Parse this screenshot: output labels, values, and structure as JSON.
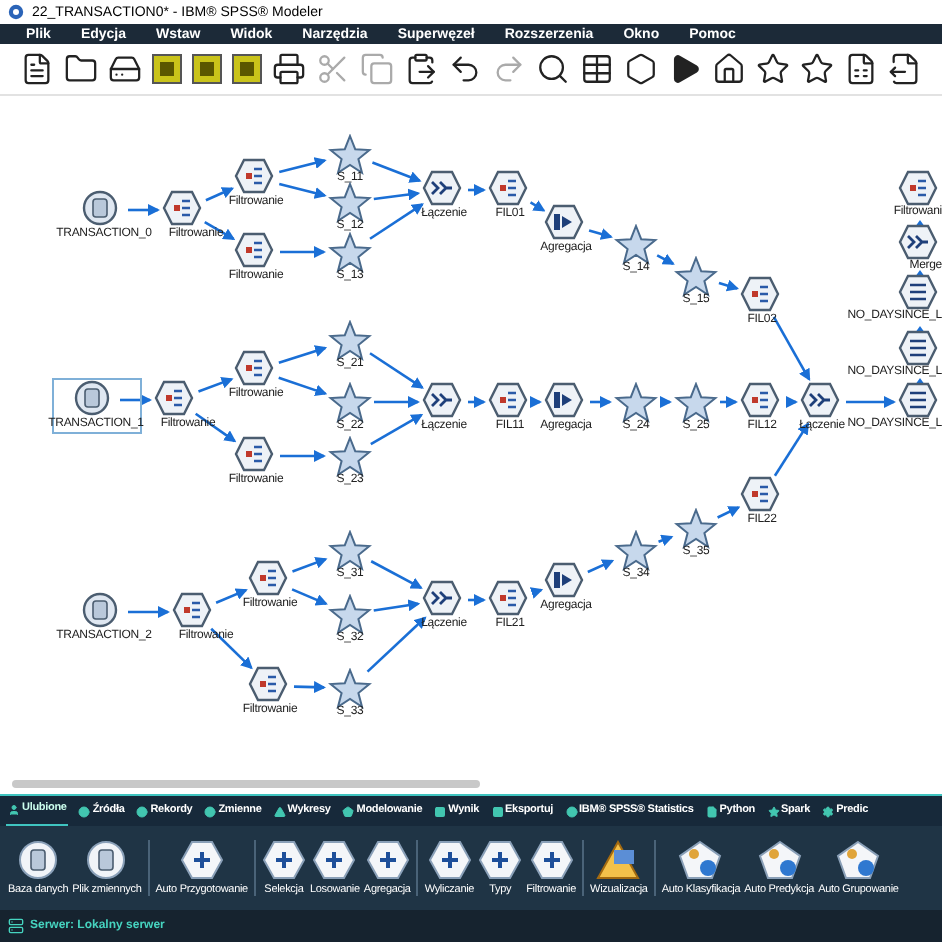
{
  "window": {
    "title": "22_TRANSACTION0* - IBM® SPSS® Modeler"
  },
  "menu": [
    "Plik",
    "Edycja",
    "Wstaw",
    "Widok",
    "Narzędzia",
    "Superwęzeł",
    "Rozszerzenia",
    "Okno",
    "Pomoc"
  ],
  "canvas": {
    "nodes": [
      {
        "label": "TRANSACTION_0",
        "kind": "database",
        "selected": false
      },
      {
        "label": "Filtrowanie",
        "kind": "filter",
        "selected": false
      },
      {
        "label": "Filtrowanie",
        "kind": "filter",
        "selected": false
      },
      {
        "label": "Filtrowanie",
        "kind": "filter",
        "selected": false
      },
      {
        "label": "S_11",
        "kind": "supernode",
        "selected": false
      },
      {
        "label": "S_12",
        "kind": "supernode",
        "selected": false
      },
      {
        "label": "S_13",
        "kind": "supernode",
        "selected": false
      },
      {
        "label": "Łączenie",
        "kind": "merge",
        "selected": false
      },
      {
        "label": "FIL01",
        "kind": "filter",
        "selected": false
      },
      {
        "label": "Agregacja",
        "kind": "aggregate",
        "selected": false
      },
      {
        "label": "S_14",
        "kind": "supernode",
        "selected": false
      },
      {
        "label": "S_15",
        "kind": "supernode",
        "selected": false
      },
      {
        "label": "FIL02",
        "kind": "filter",
        "selected": false
      },
      {
        "label": "Filtrowani",
        "kind": "filter",
        "selected": false
      },
      {
        "label": "Merge",
        "kind": "merge",
        "selected": false
      },
      {
        "label": "NO_DAYSINCE_L",
        "kind": "derive",
        "selected": false
      },
      {
        "label": "NO_DAYSINCE_L",
        "kind": "derive",
        "selected": false
      },
      {
        "label": "TRANSACTION_1",
        "kind": "database",
        "selected": true
      },
      {
        "label": "Filtrowanie",
        "kind": "filter",
        "selected": false
      },
      {
        "label": "Filtrowanie",
        "kind": "filter",
        "selected": false
      },
      {
        "label": "Filtrowanie",
        "kind": "filter",
        "selected": false
      },
      {
        "label": "S_21",
        "kind": "supernode",
        "selected": false
      },
      {
        "label": "S_22",
        "kind": "supernode",
        "selected": false
      },
      {
        "label": "S_23",
        "kind": "supernode",
        "selected": false
      },
      {
        "label": "Łączenie",
        "kind": "merge",
        "selected": false
      },
      {
        "label": "FIL11",
        "kind": "filter",
        "selected": false
      },
      {
        "label": "Agregacja",
        "kind": "aggregate",
        "selected": false
      },
      {
        "label": "S_24",
        "kind": "supernode",
        "selected": false
      },
      {
        "label": "S_25",
        "kind": "supernode",
        "selected": false
      },
      {
        "label": "FIL12",
        "kind": "filter",
        "selected": false
      },
      {
        "label": "Łączenie",
        "kind": "merge",
        "selected": false
      },
      {
        "label": "NO_DAYSINCE_L",
        "kind": "derive",
        "selected": false
      },
      {
        "label": "TRANSACTION_2",
        "kind": "database",
        "selected": false
      },
      {
        "label": "Filtrowanie",
        "kind": "filter",
        "selected": false
      },
      {
        "label": "Filtrowanie",
        "kind": "filter",
        "selected": false
      },
      {
        "label": "Filtrowanie",
        "kind": "filter",
        "selected": false
      },
      {
        "label": "S_31",
        "kind": "supernode",
        "selected": false
      },
      {
        "label": "S_32",
        "kind": "supernode",
        "selected": false
      },
      {
        "label": "S_33",
        "kind": "supernode",
        "selected": false
      },
      {
        "label": "Łączenie",
        "kind": "merge",
        "selected": false
      },
      {
        "label": "FIL21",
        "kind": "filter",
        "selected": false
      },
      {
        "label": "Agregacja",
        "kind": "aggregate",
        "selected": false
      },
      {
        "label": "S_34",
        "kind": "supernode",
        "selected": false
      },
      {
        "label": "S_35",
        "kind": "supernode",
        "selected": false
      },
      {
        "label": "FIL22",
        "kind": "filter",
        "selected": false
      }
    ]
  },
  "palette": {
    "tabs": [
      {
        "label": "Ulubione",
        "selected": true
      },
      {
        "label": "Źródła",
        "selected": false
      },
      {
        "label": "Rekordy",
        "selected": false
      },
      {
        "label": "Zmienne",
        "selected": false
      },
      {
        "label": "Wykresy",
        "selected": false
      },
      {
        "label": "Modelowanie",
        "selected": false
      },
      {
        "label": "Wynik",
        "selected": false
      },
      {
        "label": "Eksportuj",
        "selected": false
      },
      {
        "label": "IBM® SPSS® Statistics",
        "selected": false
      },
      {
        "label": "Python",
        "selected": false
      },
      {
        "label": "Spark",
        "selected": false
      },
      {
        "label": "Predic",
        "selected": false
      }
    ],
    "nodes": [
      {
        "label": "Baza danych",
        "kind": "source"
      },
      {
        "label": "Plik zmiennych",
        "kind": "source"
      },
      {
        "label": "Auto Przygotowanie",
        "kind": "prep"
      },
      {
        "label": "Selekcja",
        "kind": "record"
      },
      {
        "label": "Losowanie",
        "kind": "record"
      },
      {
        "label": "Agregacja",
        "kind": "record"
      },
      {
        "label": "Wyliczanie",
        "kind": "field"
      },
      {
        "label": "Typy",
        "kind": "field"
      },
      {
        "label": "Filtrowanie",
        "kind": "field"
      },
      {
        "label": "Wizualizacja",
        "kind": "graph"
      },
      {
        "label": "Auto Klasyfikacja",
        "kind": "model"
      },
      {
        "label": "Auto Predykcja",
        "kind": "model"
      },
      {
        "label": "Auto Grupowanie",
        "kind": "model"
      }
    ]
  },
  "status_bar": "Serwer: Lokalny serwer"
}
